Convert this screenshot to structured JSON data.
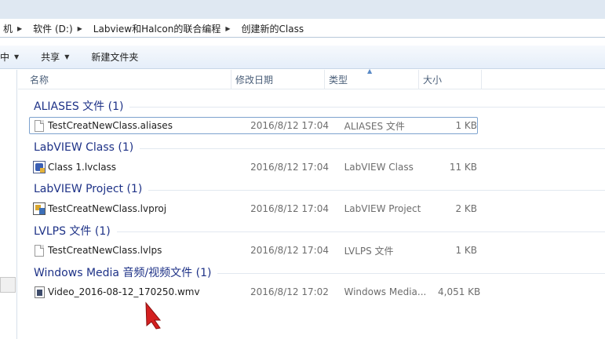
{
  "address": {
    "crumbs": [
      "机",
      "软件 (D:)",
      "Labview和Halcon的联合编程",
      "创建新的Class"
    ]
  },
  "toolbar": {
    "include_label": "中",
    "share_label": "共享",
    "new_folder_label": "新建文件夹"
  },
  "columns": {
    "name": "名称",
    "date": "修改日期",
    "type": "类型",
    "size": "大小"
  },
  "groups": [
    {
      "title": "ALIASES 文件 (1)",
      "files": [
        {
          "name": "TestCreatNewClass.aliases",
          "date": "2016/8/12 17:04",
          "type": "ALIASES 文件",
          "size": "1 KB",
          "icon": "document-icon",
          "selected": true
        }
      ]
    },
    {
      "title": "LabVIEW Class (1)",
      "files": [
        {
          "name": "Class 1.lvclass",
          "date": "2016/8/12 17:04",
          "type": "LabVIEW Class",
          "size": "11 KB",
          "icon": "lvclass-icon",
          "selected": false
        }
      ]
    },
    {
      "title": "LabVIEW Project (1)",
      "files": [
        {
          "name": "TestCreatNewClass.lvproj",
          "date": "2016/8/12 17:04",
          "type": "LabVIEW Project",
          "size": "2 KB",
          "icon": "lvproj-icon",
          "selected": false
        }
      ]
    },
    {
      "title": "LVLPS 文件 (1)",
      "files": [
        {
          "name": "TestCreatNewClass.lvlps",
          "date": "2016/8/12 17:04",
          "type": "LVLPS 文件",
          "size": "1 KB",
          "icon": "document-icon",
          "selected": false
        }
      ]
    },
    {
      "title": "Windows Media 音频/视频文件 (1)",
      "files": [
        {
          "name": "Video_2016-08-12_170250.wmv",
          "date": "2016/8/12 17:02",
          "type": "Windows Media...",
          "size": "4,051 KB",
          "icon": "wmv-video-icon",
          "selected": false
        }
      ]
    }
  ],
  "colors": {
    "group_title": "#1e3287",
    "selection_border": "#7da2ce",
    "cursor": "#d42020"
  }
}
